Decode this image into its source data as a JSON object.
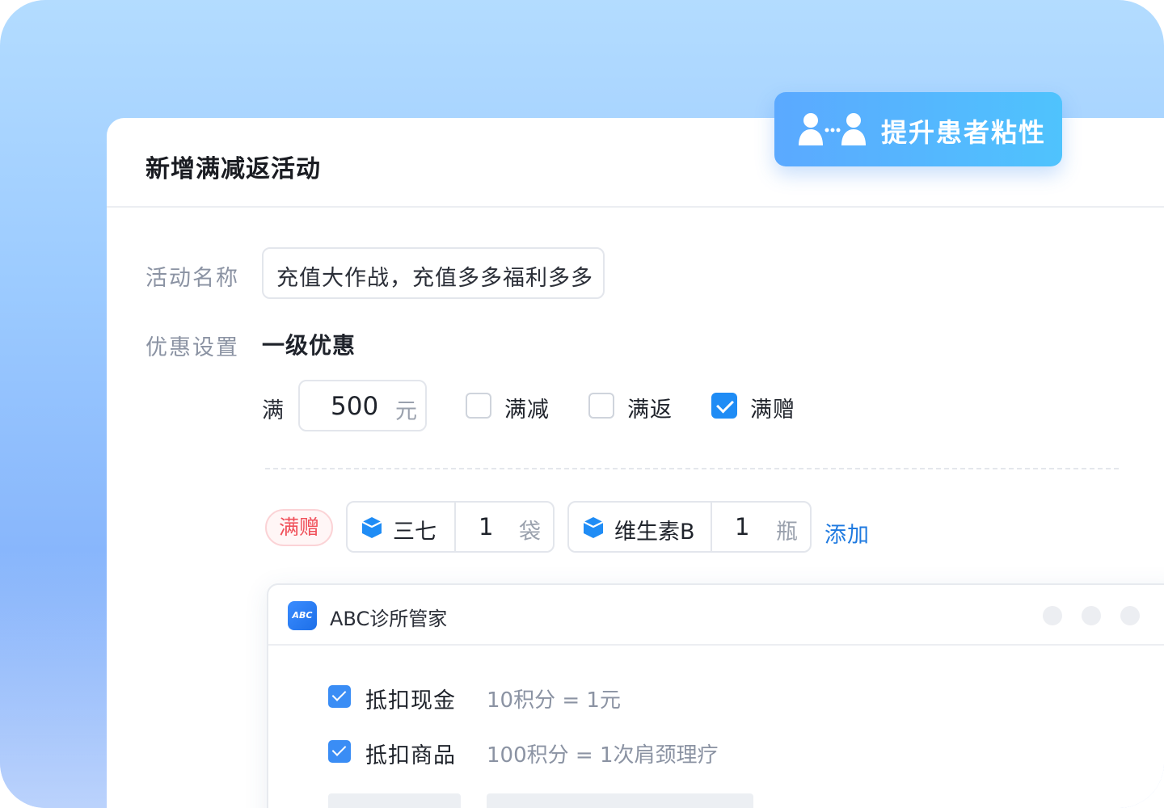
{
  "card": {
    "title": "新增满减返活动"
  },
  "badge": {
    "text": "提升患者粘性",
    "icon": "users-chat-icon"
  },
  "form": {
    "name_label": "活动名称",
    "name_value": "充值大作战，充值多多福利多多",
    "discount_label": "优惠设置",
    "level_title": "一级优惠",
    "threshold_prefix": "满",
    "threshold_value": "500",
    "threshold_unit": "元",
    "options": [
      {
        "label": "满减",
        "checked": false
      },
      {
        "label": "满返",
        "checked": false
      },
      {
        "label": "满赠",
        "checked": true
      }
    ]
  },
  "gifts": {
    "tag": "满赠",
    "items": [
      {
        "name": "三七",
        "qty": "1",
        "unit": "袋",
        "icon": "medicine-box-icon"
      },
      {
        "name": "维生素B",
        "qty": "1",
        "unit": "瓶",
        "icon": "medicine-box-icon"
      }
    ],
    "add_label": "添加"
  },
  "app_window": {
    "logo_text": "ABC",
    "name": "ABC诊所管家",
    "rows": [
      {
        "label": "抵扣现金",
        "value": "10积分  =  1元",
        "checked": true
      },
      {
        "label": "抵扣商品",
        "value": "100积分  =  1次肩颈理疗",
        "checked": true
      }
    ]
  },
  "colors": {
    "accent": "#1f8cf5",
    "link": "#1f7ae0",
    "tag_red": "#f0505a",
    "badge_start": "#5ba9ff",
    "badge_end": "#4fc3fd"
  }
}
